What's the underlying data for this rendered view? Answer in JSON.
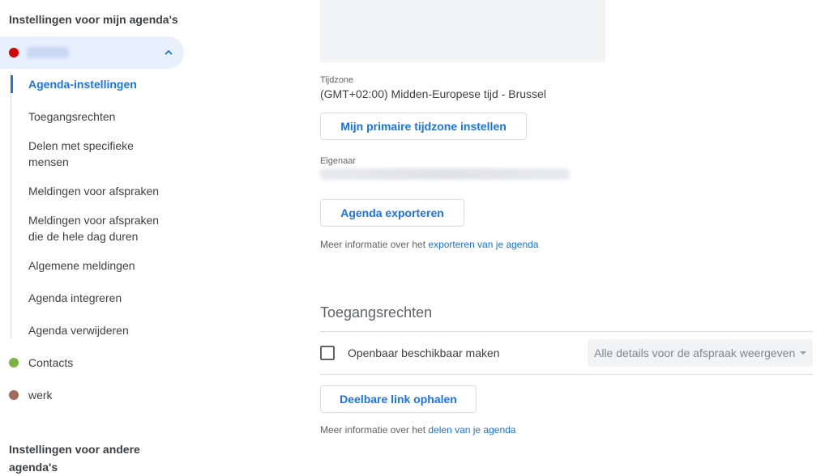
{
  "sidebar": {
    "heading_my": "Instellingen voor mijn agenda's",
    "heading_other": "Instellingen voor andere agenda's",
    "calendars": [
      {
        "name": "",
        "color": "#d50000"
      },
      {
        "name": "Contacts",
        "color": "#7cb342"
      },
      {
        "name": "werk",
        "color": "#a1695c"
      }
    ],
    "sub_items": [
      "Agenda-instellingen",
      "Toegangsrechten",
      "Delen met specifieke mensen",
      "Meldingen voor afspraken",
      "Meldingen voor afspraken die de hele dag duren",
      "Algemene meldingen",
      "Agenda integreren",
      "Agenda verwijderen"
    ]
  },
  "main": {
    "timezone_label": "Tijdzone",
    "timezone_value": "(GMT+02:00) Midden-Europese tijd - Brussel",
    "primary_tz_button": "Mijn primaire tijdzone instellen",
    "owner_label": "Eigenaar",
    "export_button": "Agenda exporteren",
    "export_info_prefix": "Meer informatie over het ",
    "export_info_link": "exporteren van je agenda",
    "access_title": "Toegangsrechten",
    "public_checkbox_label": "Openbaar beschikbaar maken",
    "details_select_value": "Alle details voor de afspraak weergeven",
    "share_link_button": "Deelbare link ophalen",
    "share_info_prefix": "Meer informatie over het ",
    "share_info_link": "delen van je agenda"
  },
  "colors": {
    "accent": "#1a73e8",
    "active_bg": "#e8f0fe"
  }
}
